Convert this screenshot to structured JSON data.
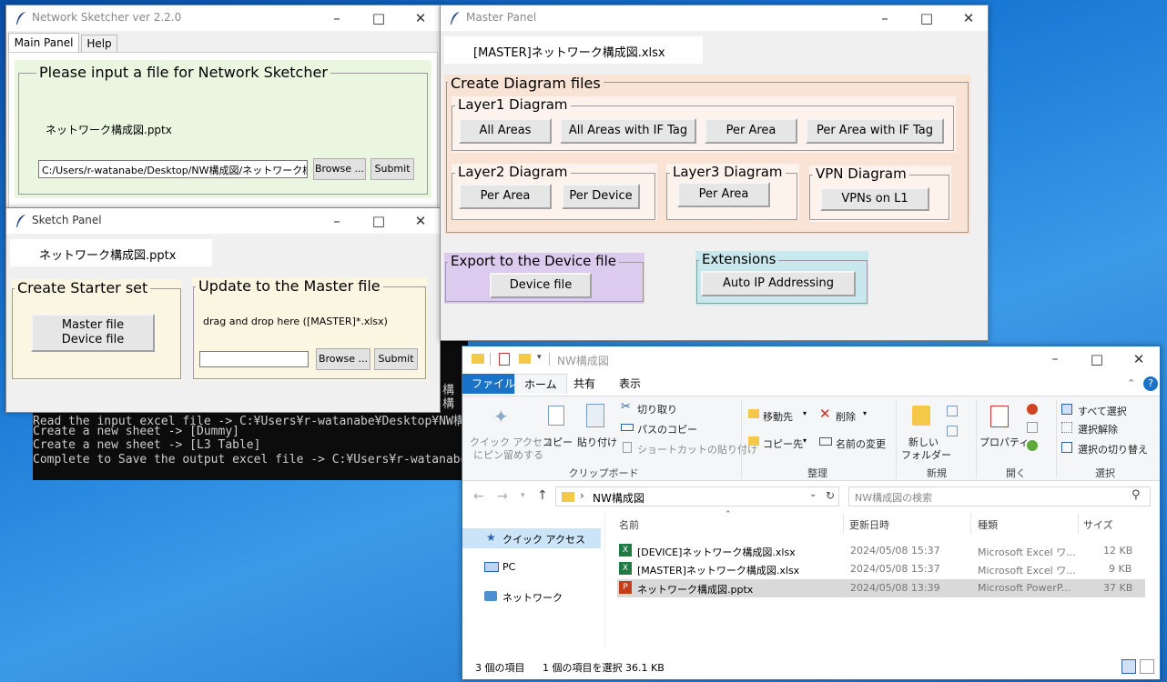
{
  "console": {
    "lines": [
      "Read the input excel file -> C:¥Users¥r-watanabe¥Desktop¥NW構",
      "Create a new sheet -> [Dummy]",
      "Create a new sheet -> [L3 Table]",
      "Complete to Save the output excel file -> C:¥Users¥r-watanabe"
    ],
    "overflow_chars": [
      "構",
      "構"
    ]
  },
  "main_window": {
    "title": "Network Sketcher  ver 2.2.0",
    "tabs": [
      "Main Panel",
      "Help"
    ],
    "frame_label": "Please input a file for Network Sketcher",
    "file_name": "ネットワーク構成図.pptx",
    "path_value": "C:/Users/r-watanabe/Desktop/NW構成図/ネットワーク構成[",
    "browse_label": "Browse ...",
    "submit_label": "Submit"
  },
  "sketch_panel": {
    "title": "Sketch Panel",
    "file_name": "ネットワーク構成図.pptx",
    "starter_label": "Create Starter set",
    "starter_button_line1": "Master file",
    "starter_button_line2": "Device file",
    "update_label": "Update to the Master file",
    "drop_hint": "drag and drop here ([MASTER]*.xlsx)",
    "browse_label": "Browse ...",
    "submit_label": "Submit"
  },
  "master_panel": {
    "title": "Master Panel",
    "file_name": "[MASTER]ネットワーク構成図.xlsx",
    "create_label": "Create Diagram files",
    "layer1": {
      "label": "Layer1  Diagram",
      "buttons": [
        "All Areas",
        "All Areas with IF Tag",
        "Per Area",
        "Per Area with IF Tag"
      ]
    },
    "layer2": {
      "label": "Layer2  Diagram",
      "buttons": [
        "Per Area",
        "Per Device"
      ]
    },
    "layer3": {
      "label": "Layer3  Diagram",
      "buttons": [
        "Per Area"
      ]
    },
    "vpn": {
      "label": "VPN  Diagram",
      "buttons": [
        "VPNs on L1"
      ]
    },
    "export": {
      "label": "Export to the Device file",
      "button": "Device file"
    },
    "extensions": {
      "label": "Extensions",
      "button": "Auto IP Addressing"
    }
  },
  "explorer": {
    "title": "NW構成図",
    "tabs": [
      "ファイル",
      "ホーム",
      "共有",
      "表示"
    ],
    "clipboard": {
      "pin_line1": "クイック アクセス",
      "pin_line2": "にピン留めする",
      "copy": "コピー",
      "paste": "貼り付け",
      "cut": "切り取り",
      "copy_path": "パスのコピー",
      "paste_shortcut": "ショートカットの貼り付け",
      "group": "クリップボード"
    },
    "organize": {
      "move_to": "移動先",
      "copy_to": "コピー先",
      "delete": "削除",
      "rename": "名前の変更",
      "group": "整理"
    },
    "new": {
      "new_folder_line1": "新しい",
      "new_folder_line2": "フォルダー",
      "group": "新規"
    },
    "open": {
      "properties": "プロパティ",
      "group": "開く"
    },
    "select": {
      "select_all": "すべて選択",
      "select_none": "選択解除",
      "invert": "選択の切り替え",
      "group": "選択"
    },
    "address": "NW構成図",
    "search_placeholder": "NW構成図の検索",
    "nav": [
      "クイック アクセス",
      "PC",
      "ネットワーク"
    ],
    "columns": [
      "名前",
      "更新日時",
      "種類",
      "サイズ"
    ],
    "files": [
      {
        "name": "[DEVICE]ネットワーク構成図.xlsx",
        "date": "2024/05/08 15:37",
        "type": "Microsoft Excel ワ...",
        "size": "12 KB",
        "kind": "excel"
      },
      {
        "name": "[MASTER]ネットワーク構成図.xlsx",
        "date": "2024/05/08 15:37",
        "type": "Microsoft Excel ワ...",
        "size": "9 KB",
        "kind": "excel"
      },
      {
        "name": "ネットワーク構成図.pptx",
        "date": "2024/05/08 13:39",
        "type": "Microsoft PowerP...",
        "size": "37 KB",
        "kind": "ppt"
      }
    ],
    "status_count": "3 個の項目",
    "status_selected": "1 個の項目を選択  36.1 KB"
  },
  "colors": {
    "main_frame_bg": "#eaf6e0",
    "sketch_frame_bg": "#fbf6e2",
    "master_create_bg": "#f8e3d4",
    "export_bg": "#dccbee",
    "extensions_bg": "#c9e8ee",
    "explorer_accent": "#1a73c7"
  }
}
